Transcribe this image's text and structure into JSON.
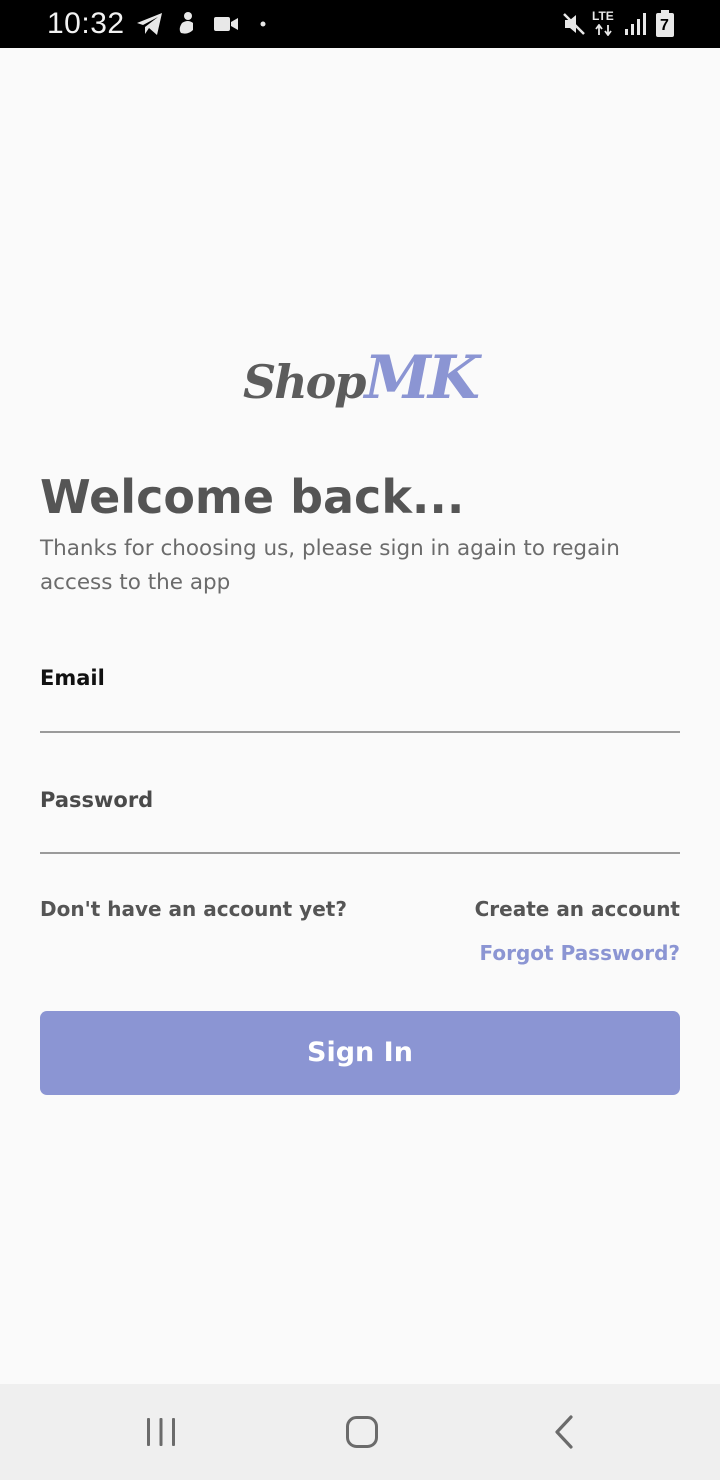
{
  "status_bar": {
    "time": "10:32",
    "network_label": "LTE",
    "battery_level": "7",
    "icons": [
      "telegram-icon",
      "person-icon",
      "video-camera-icon",
      "dot-icon",
      "mute-icon",
      "lte-icon",
      "signal-icon",
      "battery-icon"
    ]
  },
  "logo": {
    "part1": "Shop",
    "part2": "MK"
  },
  "welcome": {
    "title": "Welcome back...",
    "subtitle": "Thanks for choosing us, please sign in again to regain access to the app"
  },
  "form": {
    "email_label": "Email",
    "email_value": "",
    "password_label": "Password",
    "password_value": ""
  },
  "links": {
    "no_account": "Don't have an account yet?",
    "create_account": "Create an account",
    "forgot_password": "Forgot Password?"
  },
  "sign_in_button": "Sign In",
  "nav_bar": {
    "buttons": [
      "recent-apps-icon",
      "home-icon",
      "back-icon"
    ]
  },
  "colors": {
    "accent": "#8b95d3",
    "text_dark": "#555555",
    "background": "#fafafa",
    "status_bar": "#000000",
    "nav_bar": "#efefef"
  }
}
